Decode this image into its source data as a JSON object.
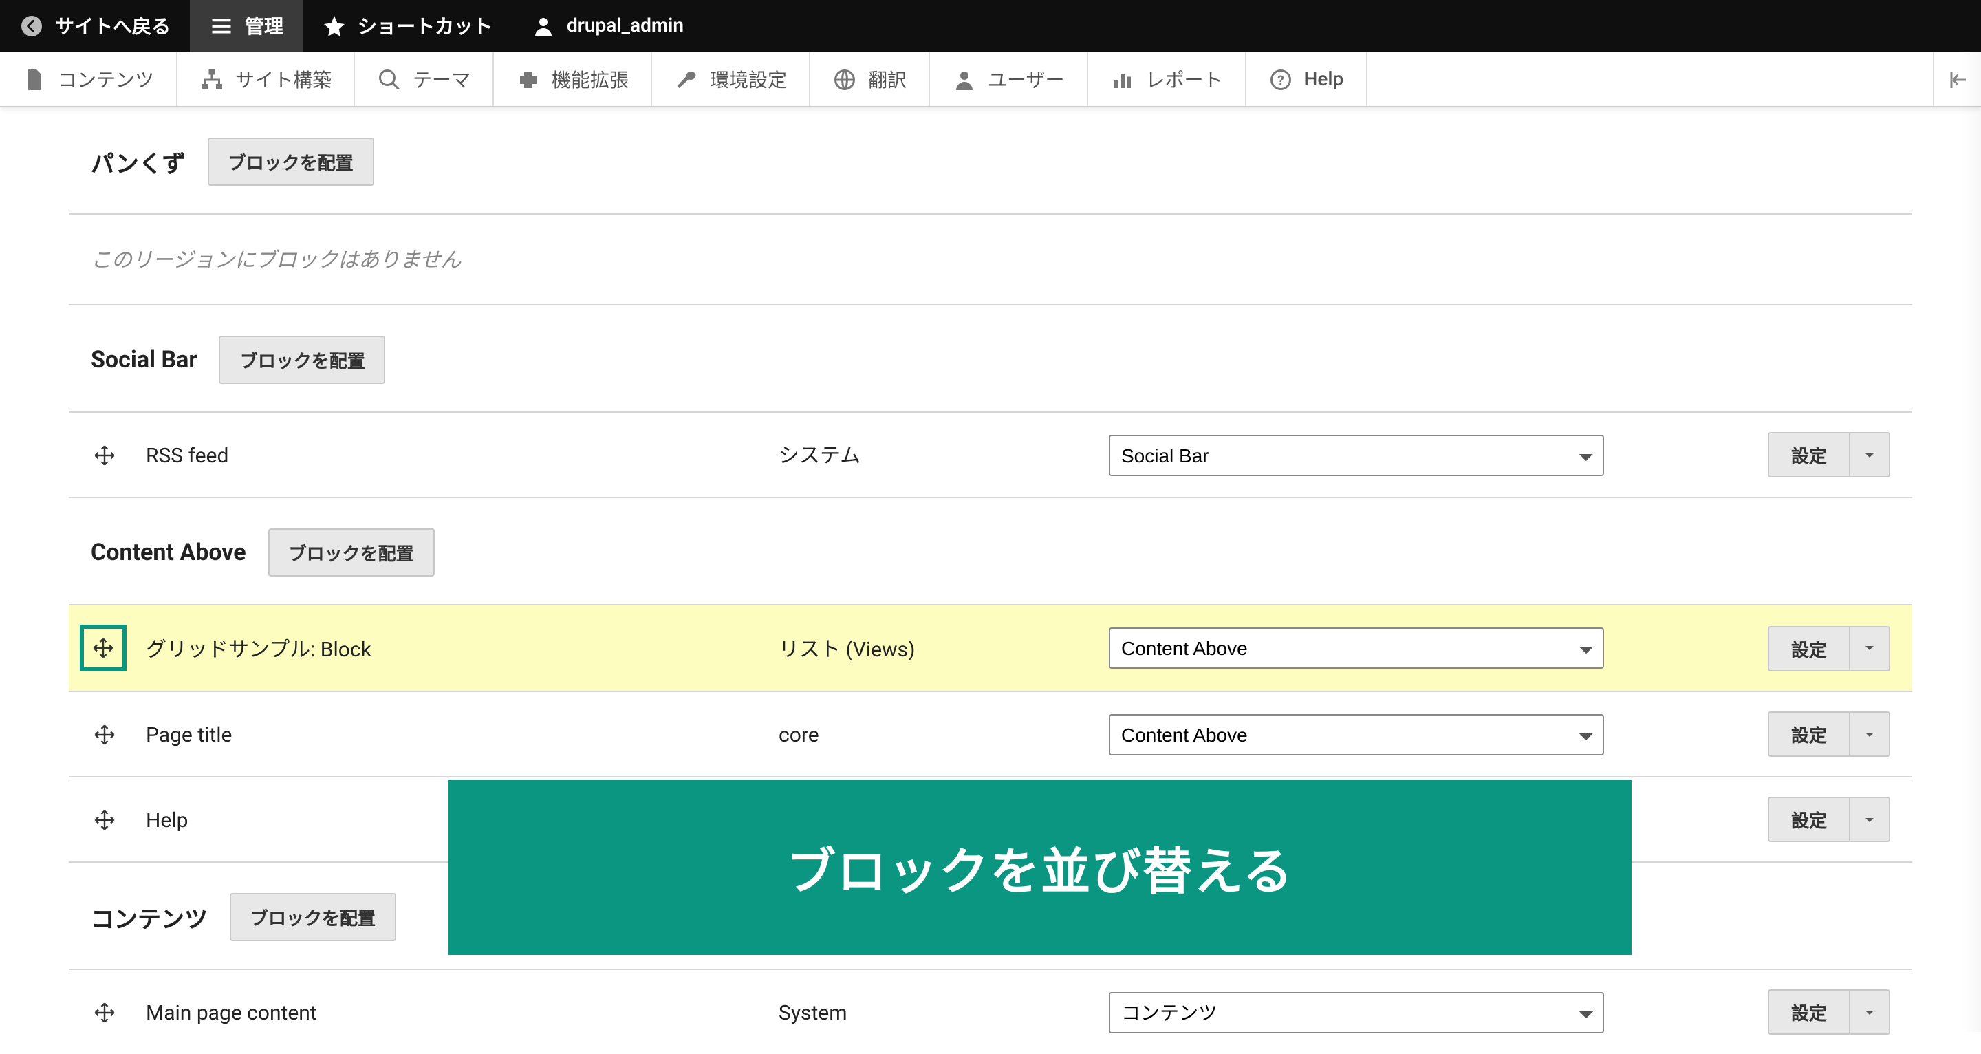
{
  "toolbar": {
    "back": "サイトへ戻る",
    "manage": "管理",
    "shortcuts": "ショートカット",
    "user": "drupal_admin"
  },
  "adminmenu": {
    "content": "コンテンツ",
    "structure": "サイト構築",
    "appearance": "テーマ",
    "extend": "機能拡張",
    "config": "環境設定",
    "translate": "翻訳",
    "people": "ユーザー",
    "reports": "レポート",
    "help": "Help"
  },
  "labels": {
    "place_block": "ブロックを配置",
    "empty_region": "このリージョンにブロックはありません",
    "ops_configure": "設定"
  },
  "callout": "ブロックを並び替える",
  "regions": [
    {
      "key": "breadcrumb",
      "title": "パンくず",
      "empty": true,
      "blocks": []
    },
    {
      "key": "social_bar",
      "title": "Social Bar",
      "empty": false,
      "blocks": [
        {
          "name": "RSS feed",
          "category": "システム",
          "select": "Social Bar",
          "highlight": false
        }
      ]
    },
    {
      "key": "content_above",
      "title": "Content Above",
      "empty": false,
      "blocks": [
        {
          "name": "グリッドサンプル: Block",
          "category": "リスト (Views)",
          "select": "Content Above",
          "highlight": true
        },
        {
          "name": "Page title",
          "category": "core",
          "select": "Content Above",
          "highlight": false
        },
        {
          "name": "Help",
          "category": "",
          "select": "",
          "highlight": false
        }
      ]
    },
    {
      "key": "content",
      "title": "コンテンツ",
      "empty": false,
      "blocks": [
        {
          "name": "Main page content",
          "category": "System",
          "select": "コンテンツ",
          "highlight": false
        }
      ]
    }
  ]
}
